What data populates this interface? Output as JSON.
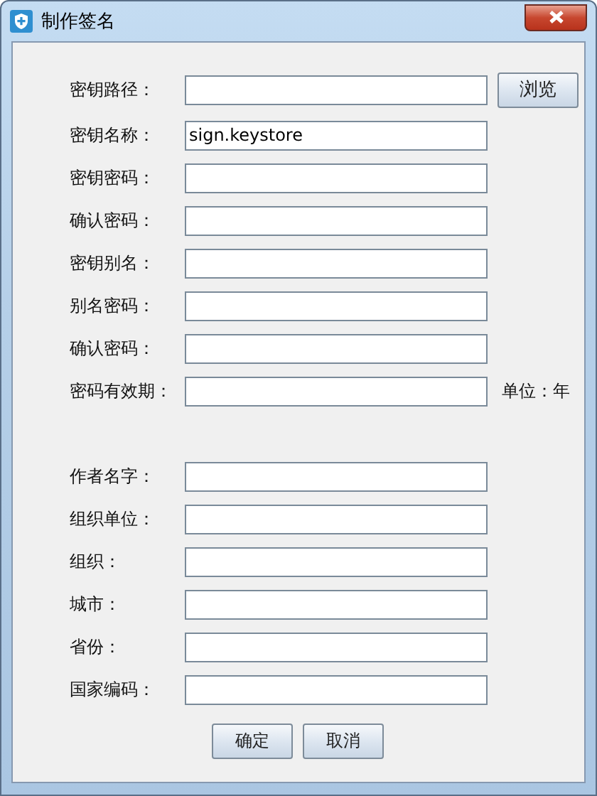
{
  "window": {
    "title": "制作签名"
  },
  "key_fields": [
    {
      "label": "密钥路径：",
      "button": "浏览"
    },
    {
      "label": "密钥名称：",
      "value": "sign.keystore"
    },
    {
      "label": "密钥密码："
    },
    {
      "label": "确认密码："
    },
    {
      "label": "密钥别名："
    },
    {
      "label": "别名密码："
    },
    {
      "label": "确认密码："
    },
    {
      "label": "密码有效期：",
      "suffix": "单位：年"
    }
  ],
  "author_fields": [
    {
      "label": "作者名字："
    },
    {
      "label": "组织单位："
    },
    {
      "label": "组织："
    },
    {
      "label": "城市："
    },
    {
      "label": "省份："
    },
    {
      "label": "国家编码："
    }
  ],
  "buttons": [
    "确定",
    "取消"
  ]
}
